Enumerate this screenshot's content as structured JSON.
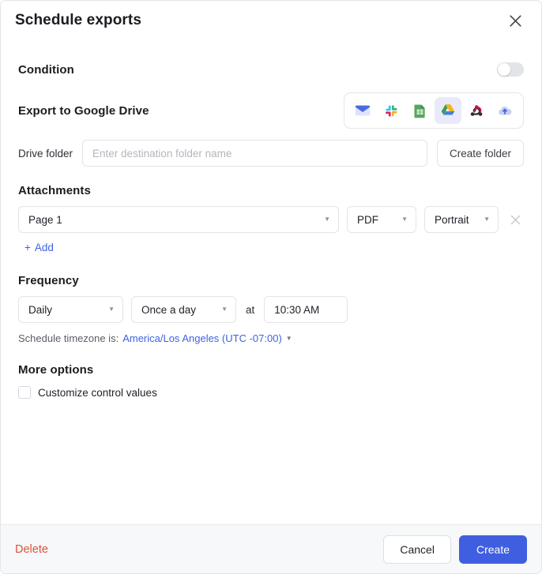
{
  "dialog": {
    "title": "Schedule exports",
    "close_icon": "close-icon"
  },
  "condition": {
    "label": "Condition",
    "enabled": false
  },
  "export": {
    "heading": "Export to Google Drive",
    "destinations": [
      {
        "name": "email-icon",
        "label": "Email",
        "selected": false
      },
      {
        "name": "slack-icon",
        "label": "Slack",
        "selected": false
      },
      {
        "name": "google-sheets-icon",
        "label": "Google Sheets",
        "selected": false
      },
      {
        "name": "google-drive-icon",
        "label": "Google Drive",
        "selected": true
      },
      {
        "name": "webhook-icon",
        "label": "Webhook",
        "selected": false
      },
      {
        "name": "cloud-upload-icon",
        "label": "Cloud storage",
        "selected": false
      }
    ]
  },
  "drive_folder": {
    "label": "Drive folder",
    "value": "",
    "placeholder": "Enter destination folder name",
    "create_button": "Create folder"
  },
  "attachments": {
    "heading": "Attachments",
    "rows": [
      {
        "page": "Page 1",
        "format": "PDF",
        "orientation": "Portrait"
      }
    ],
    "add_label": "Add",
    "add_plus": "+"
  },
  "frequency": {
    "heading": "Frequency",
    "interval": "Daily",
    "repeat": "Once a day",
    "at_label": "at",
    "time": "10:30 AM",
    "timezone_prefix": "Schedule timezone is:",
    "timezone": "America/Los Angeles (UTC -07:00)"
  },
  "more_options": {
    "heading": "More options",
    "customize_control_values": "Customize control values",
    "customize_checked": false
  },
  "footer": {
    "delete_label": "Delete",
    "cancel_label": "Cancel",
    "create_label": "Create"
  },
  "colors": {
    "accent_blue": "#3f5fe0",
    "link_blue": "#3f63e0",
    "delete_red": "#d9533a",
    "selected_bg": "#e9eaf9"
  }
}
